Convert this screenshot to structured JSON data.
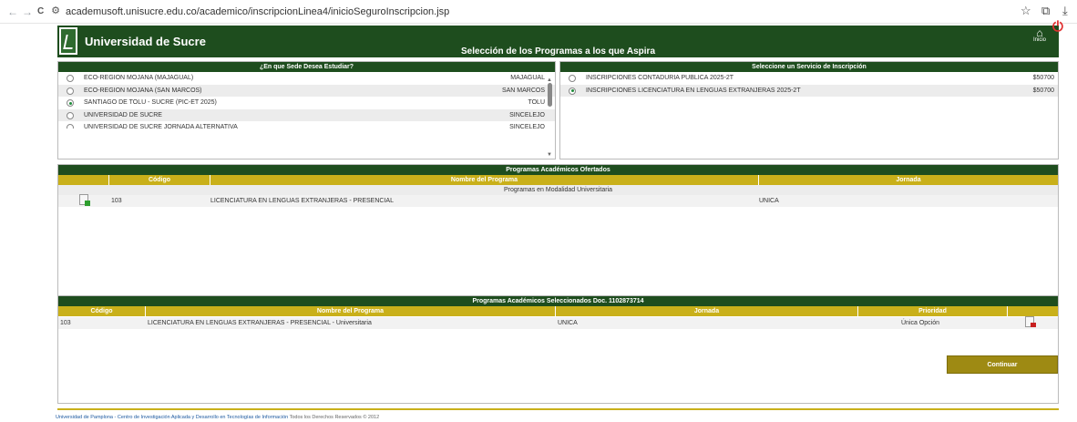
{
  "browser": {
    "back": "←",
    "forward": "→",
    "reload": "C",
    "url": "academusoft.unisucre.edu.co/academico/inscripcionLinea4/inicioSeguroInscripcion.jsp",
    "icons": [
      "star-icon",
      "extensions-icon",
      "download-icon"
    ]
  },
  "header": {
    "university": "Universidad de Sucre",
    "title": "Selección de los Programas a los que Aspira",
    "home_label": "Inicio"
  },
  "sede": {
    "title": "¿En que Sede Desea Estudiar?",
    "options": [
      {
        "label": "ECO-REGION MOJANA (MAJAGUAL)",
        "city": "MAJAGUAL",
        "selected": false
      },
      {
        "label": "ECO-REGION MOJANA (SAN MARCOS)",
        "city": "SAN MARCOS",
        "selected": false
      },
      {
        "label": "SANTIAGO DE TOLU - SUCRE (PIC-ET 2025)",
        "city": "TOLU",
        "selected": true
      },
      {
        "label": "UNIVERSIDAD DE SUCRE",
        "city": "SINCELEJO",
        "selected": false
      },
      {
        "label": "UNIVERSIDAD DE SUCRE JORNADA ALTERNATIVA",
        "city": "SINCELEJO",
        "selected": false
      }
    ]
  },
  "servicio": {
    "title": "Seleccione un Servicio de Inscripción",
    "options": [
      {
        "label": "INSCRIPCIONES CONTADURIA PUBLICA 2025-2T",
        "price": "$50700",
        "selected": false
      },
      {
        "label": "INSCRIPCIONES LICENCIATURA EN LENGUAS EXTRANJERAS 2025-2T",
        "price": "$50700",
        "selected": true
      }
    ]
  },
  "ofertados": {
    "title": "Programas Académicos Ofertados",
    "columns": [
      "Código",
      "Nombre del Programa",
      "Jornada"
    ],
    "group": "Programas en Modalidad Universitaria",
    "rows": [
      {
        "codigo": "103",
        "nombre": "LICENCIATURA EN LENGUAS EXTRANJERAS - PRESENCIAL",
        "jornada": "UNICA"
      }
    ]
  },
  "seleccionados": {
    "title": "Programas Académicos Seleccionados Doc. 1102873714",
    "columns": [
      "Código",
      "Nombre del Programa",
      "Jornada",
      "Prioridad"
    ],
    "rows": [
      {
        "codigo": "103",
        "nombre": "LICENCIATURA EN LENGUAS EXTRANJERAS - PRESENCIAL - Universitaria",
        "jornada": "UNICA",
        "prioridad": "Única Opción"
      }
    ]
  },
  "continuar_label": "Continuar",
  "footer": {
    "link": "Universidad de Pamplona - Centro de Investigación Aplicada y Desarrollo en Tecnologías de Información",
    "rest": "Todos los Derechos Reservados © 2012"
  },
  "colors": {
    "green": "#1e4d1e",
    "gold": "#c9b01a",
    "button": "#9e8a13"
  }
}
